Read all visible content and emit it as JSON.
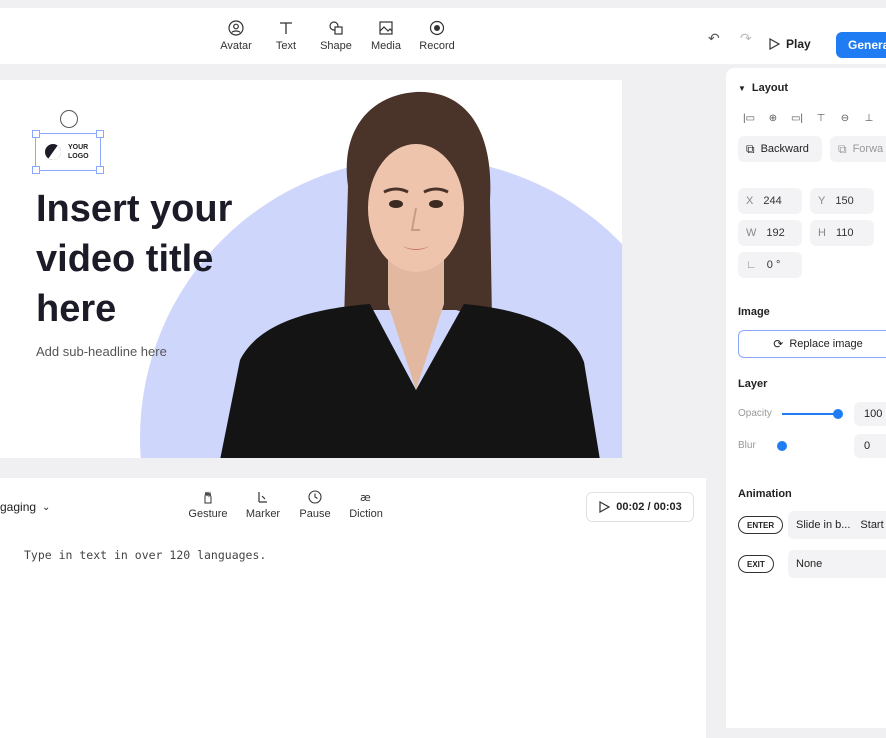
{
  "toolbar": {
    "tools": [
      {
        "label": "Avatar",
        "icon": "avatar-icon"
      },
      {
        "label": "Text",
        "icon": "text-icon"
      },
      {
        "label": "Shape",
        "icon": "shape-icon"
      },
      {
        "label": "Media",
        "icon": "media-icon"
      },
      {
        "label": "Record",
        "icon": "record-icon"
      }
    ],
    "play_label": "Play",
    "generate_label": "Generat"
  },
  "canvas": {
    "logo_line1": "YOUR",
    "logo_line2": "LOGO",
    "title_line1": "Insert your",
    "title_line2": "video title",
    "title_line3": "here",
    "subtitle": "Add sub-headline here",
    "accent_color": "#cfd6fb"
  },
  "script": {
    "voice_label": "gaging",
    "tools": [
      {
        "label": "Gesture",
        "icon": "gesture-icon"
      },
      {
        "label": "Marker",
        "icon": "marker-icon"
      },
      {
        "label": "Pause",
        "icon": "pause-icon"
      },
      {
        "label": "Diction",
        "icon": "diction-icon"
      }
    ],
    "timer": "00:02 / 00:03",
    "placeholder": "Type in text in over 120 languages."
  },
  "panel": {
    "layout_title": "Layout",
    "backward_label": "Backward",
    "forward_label": "Forwa",
    "x_label": "X",
    "x_value": "244",
    "y_label": "Y",
    "y_value": "150",
    "w_label": "W",
    "w_value": "192",
    "h_label": "H",
    "h_value": "110",
    "rotation_value": "0 °",
    "image_title": "Image",
    "replace_label": "Replace image",
    "layer_title": "Layer",
    "opacity_label": "Opacity",
    "opacity_value": "100",
    "blur_label": "Blur",
    "blur_value": "0",
    "animation_title": "Animation",
    "enter_label": "ENTER",
    "enter_value": "Slide in b...",
    "enter_start": "Start",
    "exit_label": "EXIT",
    "exit_value": "None",
    "brand_color": "#1f7cf2"
  }
}
